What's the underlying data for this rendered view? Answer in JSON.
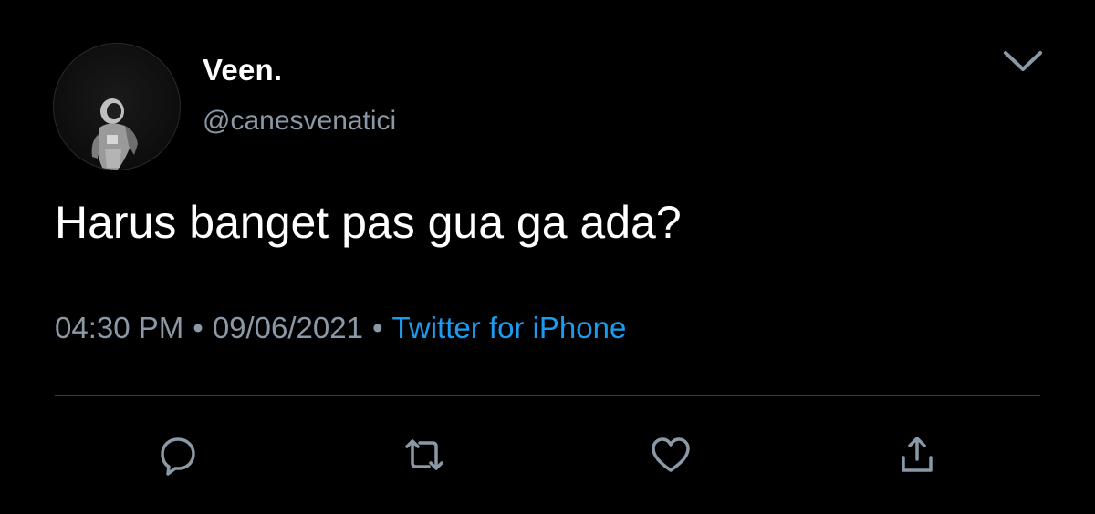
{
  "tweet": {
    "author": {
      "display_name": "Veen.",
      "handle": "@canesvenatici",
      "avatar_icon": "astronaut-avatar"
    },
    "text": "Harus banget pas gua ga ada?",
    "time": "04:30 PM",
    "date": "09/06/2021",
    "separator": "•",
    "source": "Twitter for iPhone"
  },
  "menu_icon": "chevron-down-icon",
  "actions": [
    {
      "icon": "reply-icon"
    },
    {
      "icon": "retweet-icon"
    },
    {
      "icon": "like-icon"
    },
    {
      "icon": "share-icon"
    }
  ],
  "colors": {
    "background": "#000000",
    "text": "#ffffff",
    "secondary": "#8b98a5",
    "link": "#1d9bf0",
    "divider": "#3a3d40"
  }
}
